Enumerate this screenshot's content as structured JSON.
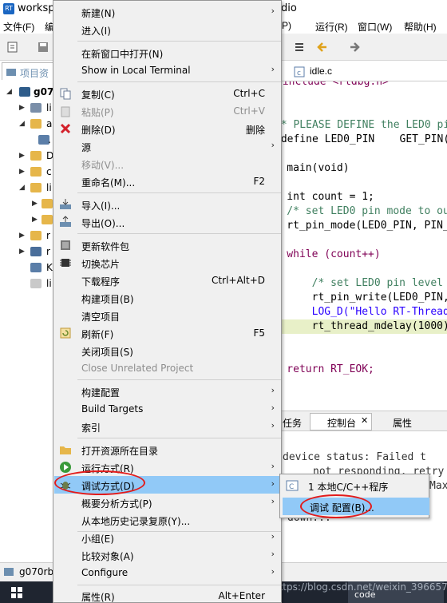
{
  "window": {
    "title_left": "worksp",
    "title_right": "dio"
  },
  "menubar": {
    "file": "文件(F)",
    "edit_partial": "编",
    "run": "运行(R)",
    "window": "窗口(W)",
    "help": "帮助(H)",
    "p_partial": "P)"
  },
  "project": {
    "tab_label": "项目资",
    "root": "g07",
    "items": [
      "li",
      ".",
      "D",
      "c",
      "li",
      "r",
      "r",
      "K",
      "li"
    ]
  },
  "editor": {
    "tab": "idle.c",
    "lines": [
      "#include <rtdbg.h>",
      "",
      "/* PLEASE DEFINE the LED0 pin f",
      "#define LED0_PIN    GET_PIN(A,",
      "",
      "int main(void)",
      "{",
      "    int count = 1;",
      "    /* set LED0 pin mode to out",
      "    rt_pin_mode(LED0_PIN, PIN_M",
      "",
      "    while (count++)",
      "    {",
      "        /* set LED0 pin level t",
      "        rt_pin_write(LED0_PIN,",
      "        LOG_D(\"Hello RT-Thread!",
      "        rt_thread_mdelay(1000);",
      "    }",
      "",
      "    return RT_EOK;"
    ]
  },
  "console": {
    "tabs": [
      "任务",
      "控制台",
      "属性"
    ],
    "lines": [
      "device status: Failed t",
      "not responding, retry",
      "Max",
      "down..."
    ]
  },
  "bottom": {
    "project_label": "g070rb"
  },
  "taskbar": {
    "app_label": "code",
    "watermark": "https://blog.csdn.net/weixin_39665790"
  },
  "context_menu": {
    "items": [
      {
        "label": "新建(N)",
        "shortcut": "",
        "submenu": true
      },
      {
        "label": "进入(I)",
        "shortcut": "",
        "submenu": false
      },
      {
        "label": "在新窗口中打开(N)",
        "shortcut": "",
        "submenu": false
      },
      {
        "label": "Show in Local Terminal",
        "shortcut": "",
        "submenu": true
      },
      {
        "label": "复制(C)",
        "shortcut": "Ctrl+C",
        "submenu": false
      },
      {
        "label": "粘贴(P)",
        "shortcut": "Ctrl+V",
        "submenu": false,
        "disabled": true
      },
      {
        "label": "删除(D)",
        "shortcut": "删除",
        "submenu": false
      },
      {
        "label": "源",
        "shortcut": "",
        "submenu": true
      },
      {
        "label": "移动(V)...",
        "shortcut": "",
        "submenu": false,
        "disabled": true
      },
      {
        "label": "重命名(M)...",
        "shortcut": "F2",
        "submenu": false
      },
      {
        "label": "导入(I)...",
        "shortcut": "",
        "submenu": false
      },
      {
        "label": "导出(O)...",
        "shortcut": "",
        "submenu": false
      },
      {
        "label": "更新软件包",
        "shortcut": "",
        "submenu": false
      },
      {
        "label": "切换芯片",
        "shortcut": "",
        "submenu": false
      },
      {
        "label": "下载程序",
        "shortcut": "Ctrl+Alt+D",
        "submenu": false
      },
      {
        "label": "构建项目(B)",
        "shortcut": "",
        "submenu": false
      },
      {
        "label": "清空项目",
        "shortcut": "",
        "submenu": false
      },
      {
        "label": "刷新(F)",
        "shortcut": "F5",
        "submenu": false
      },
      {
        "label": "关闭项目(S)",
        "shortcut": "",
        "submenu": false
      },
      {
        "label": "Close Unrelated Project",
        "shortcut": "",
        "submenu": false,
        "disabled": true
      },
      {
        "label": "构建配置",
        "shortcut": "",
        "submenu": true
      },
      {
        "label": "Build Targets",
        "shortcut": "",
        "submenu": true
      },
      {
        "label": "索引",
        "shortcut": "",
        "submenu": true
      },
      {
        "label": "打开资源所在目录",
        "shortcut": "",
        "submenu": false
      },
      {
        "label": "运行方式(R)",
        "shortcut": "",
        "submenu": true
      },
      {
        "label": "调试方式(D)",
        "shortcut": "",
        "submenu": true,
        "highlighted": true
      },
      {
        "label": "概要分析方式(P)",
        "shortcut": "",
        "submenu": true
      },
      {
        "label": "从本地历史记录复原(Y)...",
        "shortcut": "",
        "submenu": false
      },
      {
        "label": "小组(E)",
        "shortcut": "",
        "submenu": true
      },
      {
        "label": "比较对象(A)",
        "shortcut": "",
        "submenu": true
      },
      {
        "label": "Configure",
        "shortcut": "",
        "submenu": true
      },
      {
        "label": "属性(R)",
        "shortcut": "Alt+Enter",
        "submenu": false
      }
    ]
  },
  "submenu": {
    "items": [
      {
        "label": "1 本地C/C++程序"
      },
      {
        "label": "调试 配置(B)...",
        "highlighted": true
      }
    ]
  },
  "colors": {
    "menu_bg": "#f0f0f0",
    "highlight": "#91c9f7",
    "annotation_red": "#e21b1b",
    "keyword": "#7f0055",
    "string": "#2a00ff",
    "comment": "#3f7f5f"
  }
}
